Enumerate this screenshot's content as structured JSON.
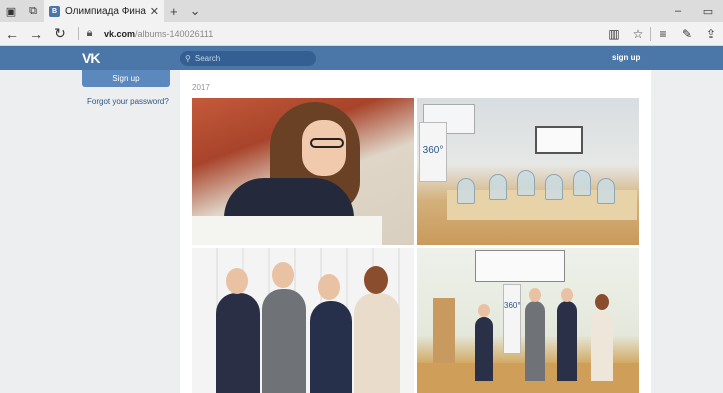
{
  "browser": {
    "tab_title": "Олимпиада Финансы I",
    "tab_favicon": "В",
    "url_domain": "vk.com",
    "url_path": "/albums-140026111"
  },
  "vk": {
    "logo": "VK",
    "search_placeholder": "Search",
    "signup_top": "sign up",
    "signup_button": "Sign up",
    "forgot_password": "Forgot your password?"
  },
  "album": {
    "year": "2017"
  },
  "photos": {
    "stand_label": "360°"
  },
  "colors": {
    "vk_blue": "#4a76a8",
    "page_bg": "#edeef0"
  },
  "icons": {
    "tab_actions": [
      "tab-preview-icon",
      "tab-aside-icon"
    ],
    "nav": [
      "back-icon",
      "forward-icon",
      "refresh-icon",
      "lock-icon"
    ],
    "right": [
      "reading-view-icon",
      "favorite-star-icon",
      "hub-icon",
      "pen-icon",
      "share-icon"
    ],
    "window": [
      "minimize-icon",
      "restore-icon"
    ]
  }
}
